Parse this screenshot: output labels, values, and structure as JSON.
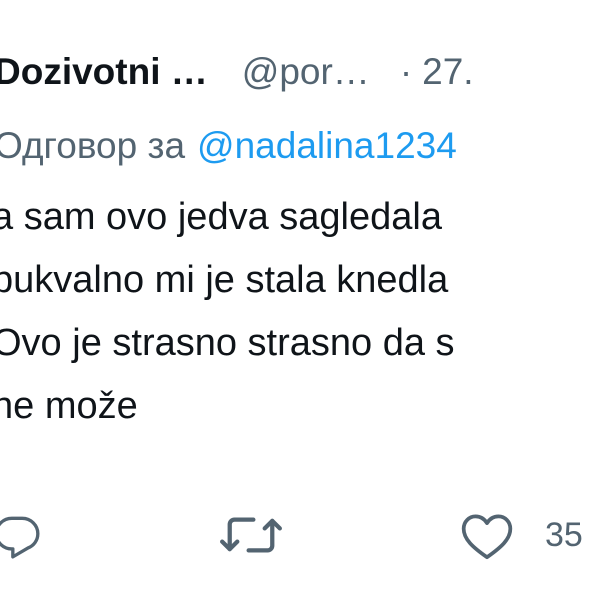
{
  "tweet": {
    "author_name": "Dozivotni …",
    "author_handle": "@por…",
    "separator": "·",
    "date": "27.",
    "reply_prefix": "Одговор за",
    "reply_to": "@nadalina1234",
    "body_lines": [
      "a sam ovo jedva sagledala",
      "pukvalno mi je stala knedla",
      "Ovo je strasno strasno da s",
      "ne može"
    ]
  },
  "actions": {
    "reply_icon": "reply-icon",
    "retweet_icon": "retweet-icon",
    "like_icon": "heart-icon",
    "like_count": "35"
  },
  "colors": {
    "text": "#0f1419",
    "secondary": "#536471",
    "link": "#1d9bf0"
  }
}
